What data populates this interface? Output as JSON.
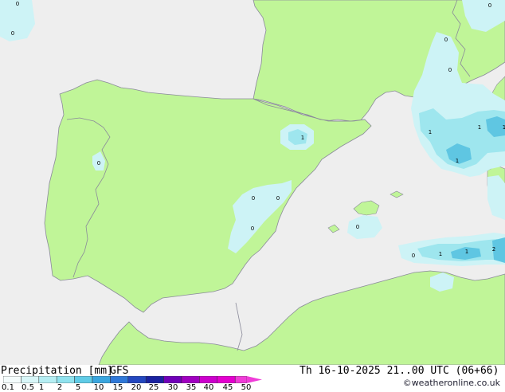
{
  "map": {
    "colors": {
      "sea": "#eeeeee",
      "land": "#c0f598",
      "border": "#8a8a9a",
      "precip_light": "#cdf3f6",
      "precip_medium": "#9ee6ee",
      "precip_heavy": "#5fc6e2"
    },
    "blob_labels": [
      "0",
      "0",
      "0",
      "1",
      "0",
      "0",
      "0",
      "0",
      "0",
      "1",
      "1",
      "1",
      "1",
      "0",
      "0",
      "1",
      "1",
      "2",
      "0"
    ]
  },
  "footer": {
    "product": "Precipitation [mm]",
    "model": "GFS",
    "datetime": "Th 16-10-2025 21..00 UTC (06+66)",
    "credit": "©weatheronline.co.uk"
  },
  "legend": {
    "ticks": [
      "0.1",
      "0.5",
      "1",
      "2",
      "5",
      "10",
      "15",
      "20",
      "25",
      "30",
      "35",
      "40",
      "45",
      "50"
    ],
    "colors": [
      "#f4fcfc",
      "#d8f6f8",
      "#b5eef3",
      "#8fe2ee",
      "#5fcbe6",
      "#3aa6de",
      "#2f78d8",
      "#2448bf",
      "#1a22a0",
      "#7000b8",
      "#a000c0",
      "#cc00cc",
      "#e400cf",
      "#f03cd8"
    ]
  }
}
